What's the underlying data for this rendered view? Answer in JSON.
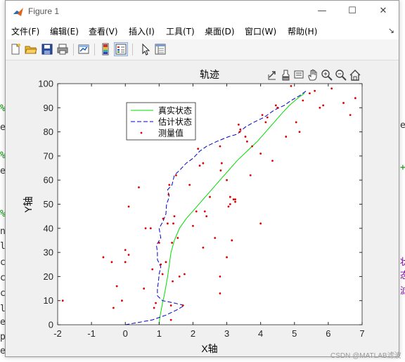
{
  "window": {
    "title": "Figure 1",
    "minimize": "—",
    "maximize": "☐",
    "close": "✕"
  },
  "menu": [
    "文件(F)",
    "编辑(E)",
    "查看(V)",
    "插入(I)",
    "工具(T)",
    "桌面(D)",
    "窗口(W)",
    "帮助(H)"
  ],
  "menu_pin": "↘",
  "toolbar_icons": [
    "new-figure-icon",
    "open-file-icon",
    "save-icon",
    "print-icon",
    "link-plot-icon",
    "insert-colorbar-icon",
    "insert-legend-icon",
    "edit-plot-arrow-icon",
    "property-inspector-icon"
  ],
  "axes_toolbar_icons": [
    "export-icon",
    "brush-icon",
    "data-tips-icon",
    "pan-hand-icon",
    "zoom-in-icon",
    "zoom-out-icon",
    "restore-view-home-icon"
  ],
  "background": {
    "left_fragments": [
      "%",
      "e",
      "%",
      "e",
      "%",
      "n",
      "l",
      "c (",
      "c (",
      "c (",
      "le",
      "e",
      "pe",
      "er"
    ],
    "right_fragments": [
      "e",
      "+",
      "状",
      "态",
      "滤"
    ],
    "watermark": "CSDN @MATLAB滤波"
  },
  "colors": {
    "true_state": "#00dd00",
    "estimate": "#0000cc",
    "measurement": "#dd0000",
    "title_bar_bg": "#ffffff",
    "window_bg": "#f0f0f0"
  },
  "chart_data": {
    "type": "line",
    "title": "轨迹",
    "xlabel": "X轴",
    "ylabel": "Y轴",
    "xlim": [
      -2,
      7
    ],
    "ylim": [
      0,
      100
    ],
    "xticks": [
      "-2",
      "-1",
      "0",
      "1",
      "2",
      "3",
      "4",
      "5",
      "6",
      "7"
    ],
    "yticks": [
      "0",
      "10",
      "20",
      "30",
      "40",
      "50",
      "60",
      "70",
      "80",
      "90",
      "100"
    ],
    "grid": false,
    "legend_position": "upper-left inside",
    "series": [
      {
        "name": "真实状态",
        "style": "solid",
        "color": "#00dd00",
        "points": [
          [
            1.0,
            0
          ],
          [
            1.02,
            3
          ],
          [
            1.06,
            6
          ],
          [
            1.1,
            9
          ],
          [
            1.15,
            12
          ],
          [
            1.2,
            16
          ],
          [
            1.25,
            20
          ],
          [
            1.3,
            25
          ],
          [
            1.35,
            30
          ],
          [
            1.45,
            35
          ],
          [
            1.6,
            40
          ],
          [
            1.8,
            44
          ],
          [
            2.05,
            48
          ],
          [
            2.3,
            52
          ],
          [
            2.55,
            56
          ],
          [
            2.8,
            60
          ],
          [
            3.05,
            64
          ],
          [
            3.3,
            68
          ],
          [
            3.6,
            72
          ],
          [
            3.9,
            76
          ],
          [
            4.15,
            80
          ],
          [
            4.4,
            84
          ],
          [
            4.65,
            88
          ],
          [
            4.85,
            91
          ],
          [
            5.1,
            94
          ],
          [
            5.3,
            96
          ]
        ]
      },
      {
        "name": "估计状态",
        "style": "dashed",
        "color": "#0000cc",
        "points": [
          [
            0,
            0
          ],
          [
            0.4,
            1
          ],
          [
            0.8,
            2
          ],
          [
            1.2,
            4
          ],
          [
            1.5,
            6
          ],
          [
            1.75,
            8
          ],
          [
            1.45,
            9
          ],
          [
            1.1,
            10
          ],
          [
            0.95,
            12
          ],
          [
            0.95,
            15
          ],
          [
            0.98,
            18
          ],
          [
            1.0,
            21
          ],
          [
            1.05,
            24
          ],
          [
            0.95,
            27
          ],
          [
            0.95,
            30
          ],
          [
            0.92,
            33
          ],
          [
            1.05,
            36
          ],
          [
            1.0,
            40
          ],
          [
            1.12,
            43
          ],
          [
            1.2,
            46
          ],
          [
            1.22,
            50
          ],
          [
            1.3,
            53
          ],
          [
            1.25,
            56
          ],
          [
            1.38,
            58
          ],
          [
            1.45,
            62
          ],
          [
            1.6,
            64
          ],
          [
            1.8,
            67
          ],
          [
            2.0,
            69
          ],
          [
            2.2,
            72
          ],
          [
            2.4,
            74
          ],
          [
            2.7,
            76
          ],
          [
            3.05,
            78
          ],
          [
            3.3,
            79
          ],
          [
            3.55,
            82
          ],
          [
            3.8,
            84
          ],
          [
            4.1,
            86
          ],
          [
            4.4,
            89
          ],
          [
            4.7,
            91
          ],
          [
            4.9,
            93
          ],
          [
            5.15,
            95
          ],
          [
            5.35,
            97
          ]
        ]
      },
      {
        "name": "测量值",
        "style": "markers",
        "color": "#dd0000",
        "points": [
          [
            -1.85,
            10
          ],
          [
            -0.65,
            28
          ],
          [
            -0.4,
            26
          ],
          [
            -0.35,
            7
          ],
          [
            -0.25,
            16
          ],
          [
            -0.1,
            10
          ],
          [
            0,
            31
          ],
          [
            0,
            26
          ],
          [
            0.1,
            29
          ],
          [
            0.1,
            49
          ],
          [
            0.4,
            57
          ],
          [
            0.55,
            15
          ],
          [
            0.6,
            40
          ],
          [
            0.75,
            40
          ],
          [
            0.8,
            23
          ],
          [
            0.85,
            7
          ],
          [
            0.9,
            9
          ],
          [
            1.0,
            34
          ],
          [
            1.05,
            25
          ],
          [
            1.1,
            21
          ],
          [
            1.12,
            44
          ],
          [
            1.2,
            26
          ],
          [
            1.25,
            42
          ],
          [
            1.28,
            54
          ],
          [
            1.3,
            58
          ],
          [
            1.35,
            2
          ],
          [
            1.35,
            8
          ],
          [
            1.38,
            34
          ],
          [
            1.4,
            18
          ],
          [
            1.42,
            42
          ],
          [
            1.45,
            45
          ],
          [
            1.5,
            62
          ],
          [
            1.55,
            36
          ],
          [
            1.6,
            20
          ],
          [
            1.7,
            8
          ],
          [
            1.75,
            21
          ],
          [
            1.9,
            58
          ],
          [
            2.0,
            41
          ],
          [
            2.1,
            47
          ],
          [
            2.15,
            73
          ],
          [
            2.2,
            66
          ],
          [
            2.3,
            32
          ],
          [
            2.3,
            67
          ],
          [
            2.35,
            47
          ],
          [
            2.4,
            45
          ],
          [
            2.5,
            53
          ],
          [
            2.65,
            36
          ],
          [
            2.8,
            13
          ],
          [
            2.8,
            20
          ],
          [
            2.8,
            74
          ],
          [
            2.82,
            64
          ],
          [
            2.85,
            67
          ],
          [
            3.0,
            28
          ],
          [
            3.0,
            60
          ],
          [
            3.05,
            49
          ],
          [
            3.1,
            50
          ],
          [
            3.1,
            53
          ],
          [
            3.15,
            35
          ],
          [
            3.2,
            52
          ],
          [
            3.25,
            51
          ],
          [
            3.25,
            52
          ],
          [
            3.35,
            83
          ],
          [
            3.38,
            80
          ],
          [
            3.4,
            81
          ],
          [
            3.55,
            78
          ],
          [
            3.6,
            76
          ],
          [
            3.7,
            62
          ],
          [
            3.75,
            74
          ],
          [
            4.0,
            42
          ],
          [
            4.0,
            71
          ],
          [
            4.05,
            87
          ],
          [
            4.15,
            84
          ],
          [
            4.2,
            86
          ],
          [
            4.35,
            68
          ],
          [
            4.45,
            91
          ],
          [
            4.5,
            90
          ],
          [
            4.75,
            78
          ],
          [
            4.9,
            99
          ],
          [
            5.05,
            84
          ],
          [
            5.15,
            80
          ],
          [
            5.25,
            93
          ],
          [
            5.45,
            96
          ],
          [
            5.6,
            97
          ],
          [
            5.75,
            90
          ],
          [
            5.85,
            91
          ],
          [
            6.1,
            98
          ],
          [
            6.45,
            92
          ],
          [
            6.65,
            87
          ],
          [
            6.8,
            94
          ]
        ]
      }
    ]
  }
}
